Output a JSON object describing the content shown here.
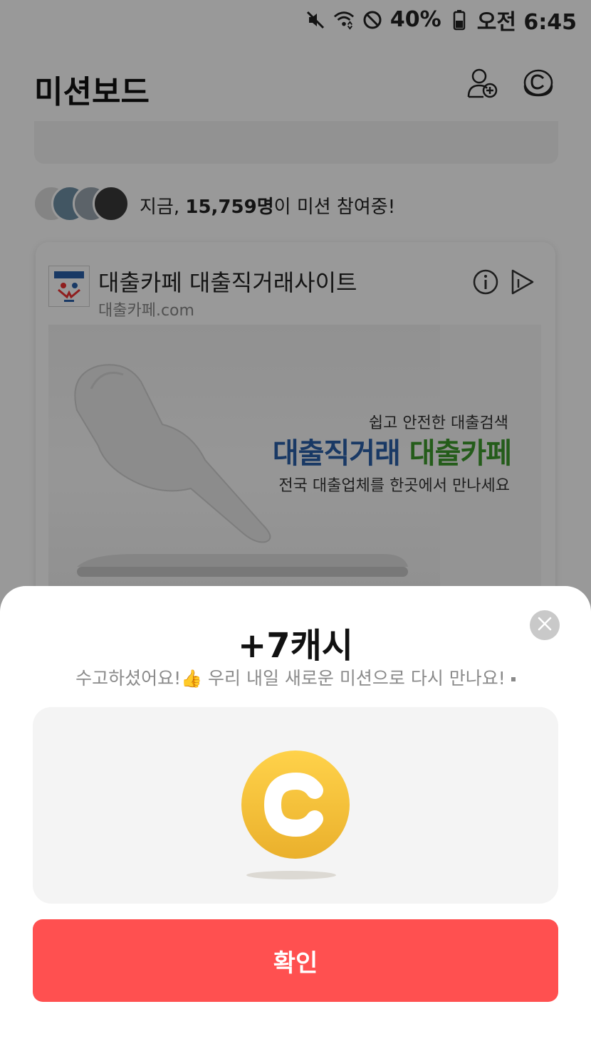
{
  "status_bar": {
    "battery_percent": "40%",
    "time": "오전 6:45",
    "icons": [
      "mute-icon",
      "wifi-icon",
      "block-icon",
      "battery-icon"
    ]
  },
  "header": {
    "title": "미션보드",
    "icons": [
      "add-friend-icon",
      "cash-coin-icon"
    ]
  },
  "participants": {
    "prefix": "지금, ",
    "count": "15,759명",
    "suffix": "이 미션 참여중!"
  },
  "ad": {
    "title": "대출카페 대출직거래사이트",
    "url": "대출카페.com",
    "logo_text": "대출카페",
    "image_copy_small": "쉽고 안전한 대출검색",
    "image_copy_big_blue": "대출직거래",
    "image_copy_big_green": "대출카페",
    "image_copy_sub": "전국 대출업체를 한곳에서 만나세요",
    "icons": [
      "info-icon",
      "ad-choices-icon"
    ]
  },
  "reward_sheet": {
    "title": "+7캐시",
    "message_start": "수고하셨어요!",
    "thumbs": "👍",
    "message_end": " 우리 내일 새로운 미션으로 다시 만나요!",
    "confirm_label": "확인",
    "icons": [
      "close-icon",
      "coin-icon"
    ]
  },
  "colors": {
    "accent": "#ff5050",
    "coin_gold": "#f5c23a",
    "ad_blue": "#2a5fa8",
    "ad_green": "#3c9a2c"
  }
}
